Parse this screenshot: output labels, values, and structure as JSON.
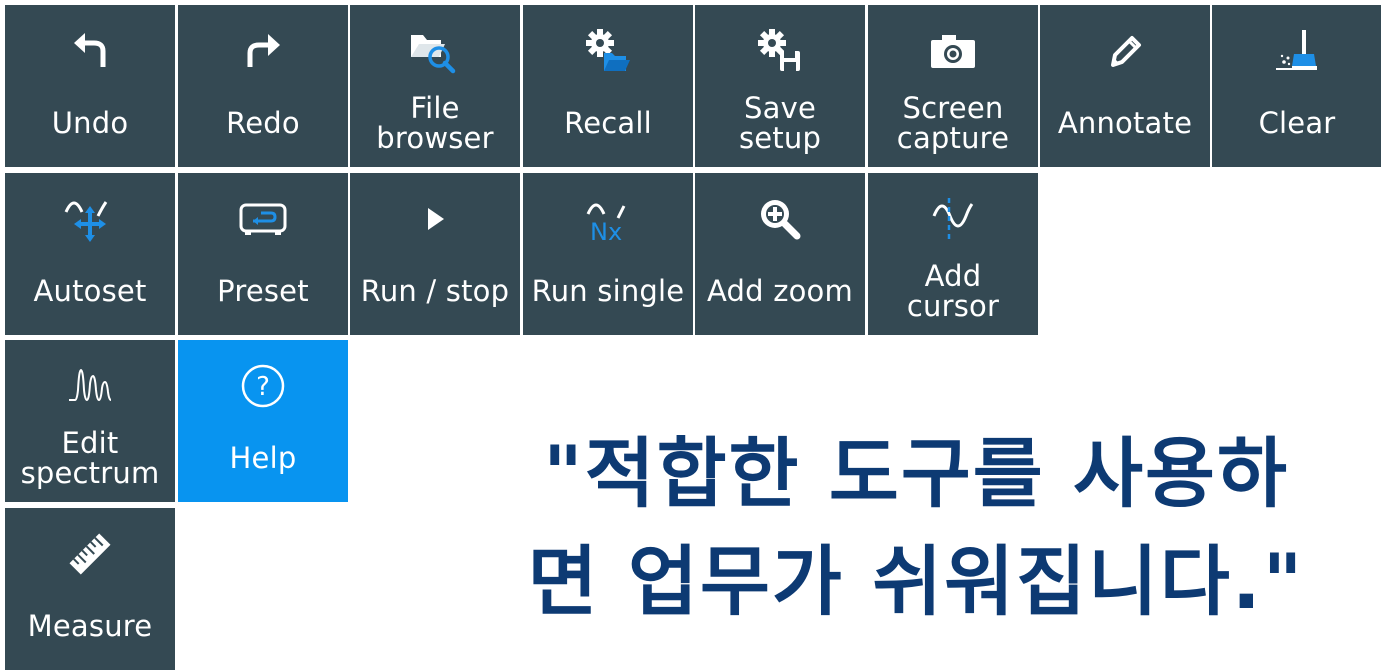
{
  "tiles": {
    "undo": {
      "label": "Undo",
      "icon": "undo-arrow-icon"
    },
    "redo": {
      "label": "Redo",
      "icon": "redo-arrow-icon"
    },
    "file_browser": {
      "label": "File\nbrowser",
      "icon": "folder-search-icon"
    },
    "recall": {
      "label": "Recall",
      "icon": "gear-folder-icon"
    },
    "save_setup": {
      "label": "Save\nsetup",
      "icon": "gear-floppy-icon"
    },
    "screen_capture": {
      "label": "Screen\ncapture",
      "icon": "camera-icon"
    },
    "annotate": {
      "label": "Annotate",
      "icon": "pencil-icon"
    },
    "clear": {
      "label": "Clear",
      "icon": "broom-icon"
    },
    "autoset": {
      "label": "Autoset",
      "icon": "wave-move-icon"
    },
    "preset": {
      "label": "Preset",
      "icon": "preset-device-icon"
    },
    "run_stop": {
      "label": "Run / stop",
      "icon": "play-icon"
    },
    "run_single": {
      "label": "Run single",
      "icon": "wave-nx-icon"
    },
    "add_zoom": {
      "label": "Add zoom",
      "icon": "zoom-in-icon"
    },
    "add_cursor": {
      "label": "Add\ncursor",
      "icon": "wave-cursor-icon"
    },
    "edit_spectrum": {
      "label": "Edit\nspectrum",
      "icon": "spectrum-icon"
    },
    "help": {
      "label": "Help",
      "icon": "question-circle-icon"
    },
    "measure": {
      "label": "Measure",
      "icon": "ruler-icon"
    }
  },
  "quote": {
    "line1": "\"적합한 도구를 사용하",
    "line2": "면 업무가 쉬워집니다.\""
  },
  "colors": {
    "tile_bg": "#344953",
    "help_bg": "#0894f0",
    "accent_blue": "#1e8fe6",
    "quote_text": "#0d3a73"
  }
}
